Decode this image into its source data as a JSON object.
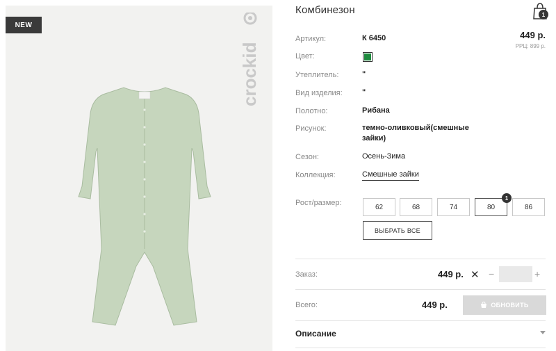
{
  "badge": {
    "label": "NEW"
  },
  "brand": {
    "logo_text": "crockid"
  },
  "product": {
    "title": "Комбинезон",
    "price": "449 р.",
    "rrp": "РРЦ: 899 р.",
    "color_hex": "#1e8a3e",
    "garment_color": "#c6d6bd",
    "attributes": {
      "article": {
        "label": "Артикул:",
        "value": "К 6450"
      },
      "color": {
        "label": "Цвет:"
      },
      "insulation": {
        "label": "Утеплитель:",
        "value": "\""
      },
      "item_type": {
        "label": "Вид изделия:",
        "value": "\""
      },
      "fabric": {
        "label": "Полотно:",
        "value": "Рибана"
      },
      "pattern": {
        "label": "Рисунок:",
        "value_line1": "темно-оливковый(смешные",
        "value_line2": "зайки)"
      },
      "season": {
        "label": "Сезон:",
        "value": "Осень-Зима"
      },
      "collection": {
        "label": "Коллекция:",
        "value": "Смешные зайки"
      }
    }
  },
  "cart": {
    "count": "1",
    "icon": "shopping-bag-icon"
  },
  "sizes": {
    "label": "Рост/размер:",
    "options": [
      "62",
      "68",
      "74",
      "80",
      "86"
    ],
    "selected": "80",
    "selected_count": "1",
    "select_all_label": "ВЫБРАТЬ ВСЕ"
  },
  "order": {
    "label": "Заказ:",
    "price": "449 р.",
    "remove_glyph": "✕",
    "minus_glyph": "−",
    "plus_glyph": "+",
    "quantity": ""
  },
  "total": {
    "label": "Всего:",
    "price": "449 р.",
    "update_label": "ОБНОВИТЬ"
  },
  "description": {
    "label": "Описание"
  }
}
